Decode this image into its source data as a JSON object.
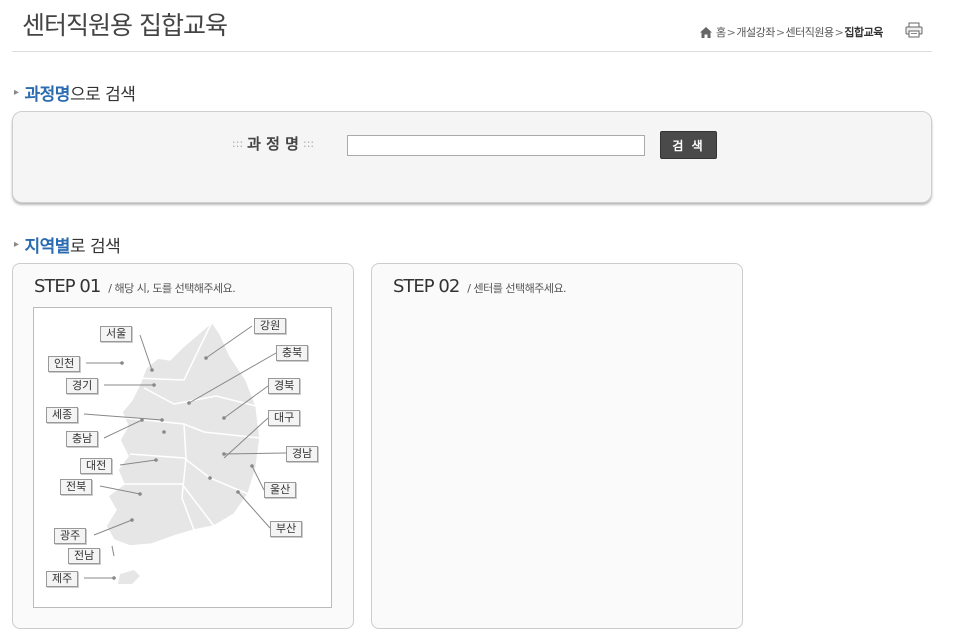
{
  "header": {
    "title": "센터직원용 집합교육",
    "breadcrumb": {
      "home": "홈",
      "sep1": ">",
      "level1": "개설강좌",
      "sep2": ">",
      "level2": "센터직원용",
      "sep3": ">",
      "current": "집합교육"
    }
  },
  "course_search": {
    "title_highlight": "과정명",
    "title_rest": "으로 검색",
    "label": "과 정 명",
    "label_dots": ":::",
    "input_value": "",
    "button_label": "검 색"
  },
  "region_search": {
    "title_highlight": "지역별",
    "title_rest": "로 검색",
    "step1": {
      "head": "STEP 01",
      "desc": "/ 해당 시, 도를 선택해주세요."
    },
    "step2": {
      "head": "STEP 02",
      "desc": "/ 센터를 선택해주세요."
    },
    "regions": [
      "서울",
      "강원",
      "인천",
      "충북",
      "경기",
      "경북",
      "세종",
      "대구",
      "충남",
      "경남",
      "대전",
      "울산",
      "전북",
      "부산",
      "광주",
      "전남",
      "제주"
    ]
  },
  "icons": {
    "home": "home-icon",
    "print": "printer-icon",
    "bullet": "triangle-bullet-icon"
  },
  "colors": {
    "accent": "#2b6cb0",
    "button": "#4a4a4a",
    "map_fill": "#e6e6e6"
  }
}
